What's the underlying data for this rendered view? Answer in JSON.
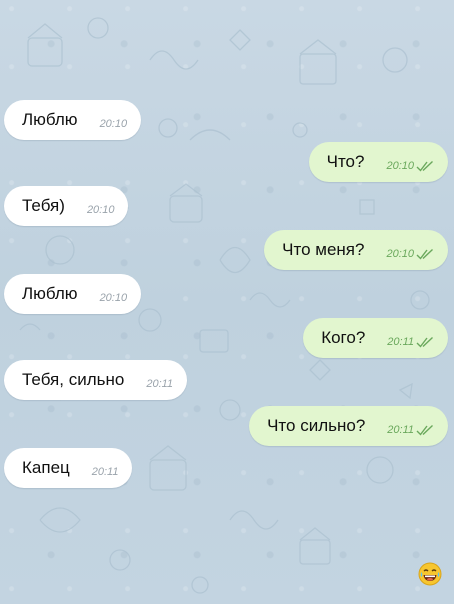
{
  "colors": {
    "background": "#c6d6e2",
    "incoming_bubble": "#ffffff",
    "outgoing_bubble": "#e2f6cf",
    "outgoing_time": "#6aa85c",
    "incoming_time": "#9aa3ab"
  },
  "messages": [
    {
      "direction": "incoming",
      "text": "Люблю",
      "time": "20:10"
    },
    {
      "direction": "outgoing",
      "text": "Что?",
      "time": "20:10",
      "status": "read-double-check-icon"
    },
    {
      "direction": "incoming",
      "text": "Тебя)",
      "time": "20:10"
    },
    {
      "direction": "outgoing",
      "text": "Что меня?",
      "time": "20:10",
      "status": "read-double-check-icon"
    },
    {
      "direction": "incoming",
      "text": "Люблю",
      "time": "20:10"
    },
    {
      "direction": "outgoing",
      "text": "Кого?",
      "time": "20:11",
      "status": "read-double-check-icon"
    },
    {
      "direction": "incoming",
      "text": "Тебя, сильно",
      "time": "20:11"
    },
    {
      "direction": "outgoing",
      "text": "Что сильно?",
      "time": "20:11",
      "status": "read-double-check-icon"
    },
    {
      "direction": "incoming",
      "text": "Капец",
      "time": "20:11"
    }
  ],
  "overlay_icon": "laughing-emoji-icon"
}
